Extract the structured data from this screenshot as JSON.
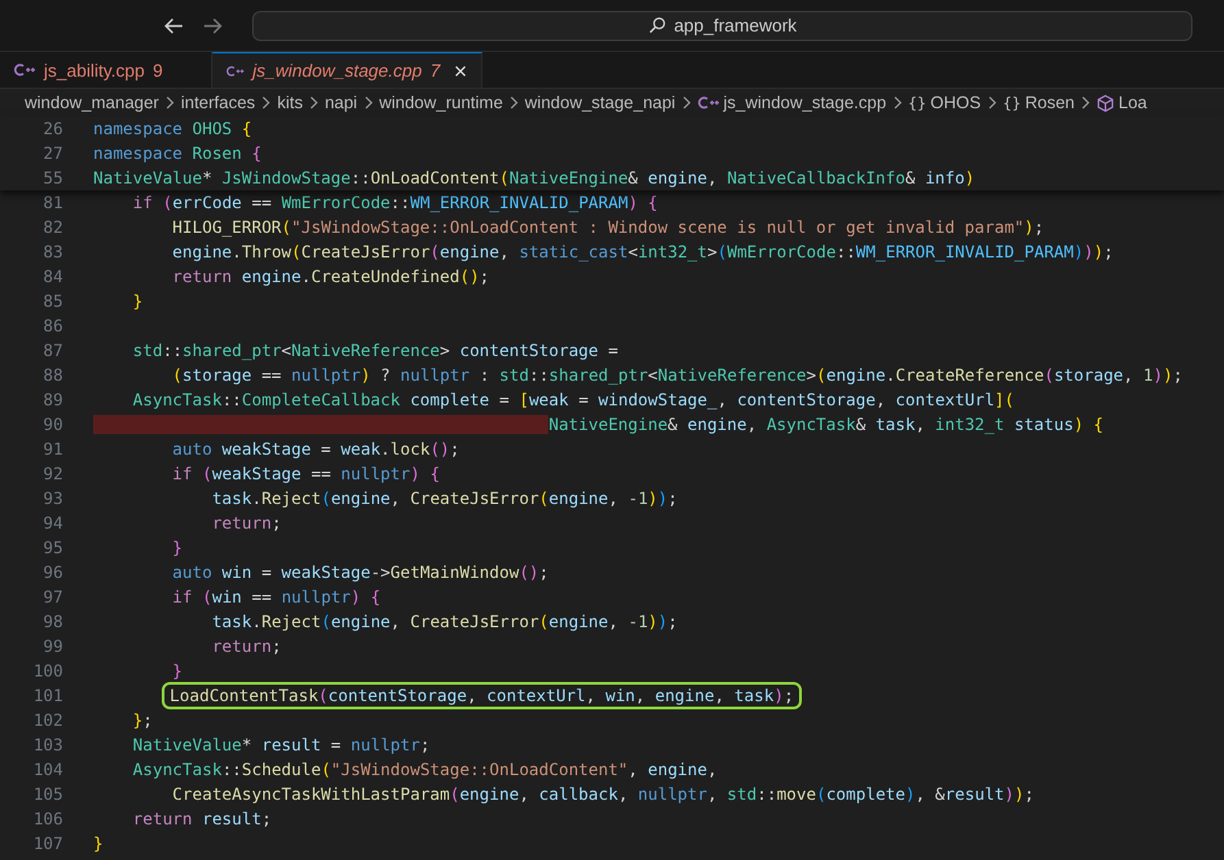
{
  "title_bar": {
    "search": "app_framework"
  },
  "tabs": [
    {
      "label": "js_ability.cpp",
      "problems": "9",
      "selected": false
    },
    {
      "label": "js_window_stage.cpp",
      "problems": "7",
      "selected": true
    }
  ],
  "breadcrumbs": [
    {
      "kind": "folder",
      "text": "window_manager"
    },
    {
      "kind": "folder",
      "text": "interfaces"
    },
    {
      "kind": "folder",
      "text": "kits"
    },
    {
      "kind": "folder",
      "text": "napi"
    },
    {
      "kind": "folder",
      "text": "window_runtime"
    },
    {
      "kind": "folder",
      "text": "window_stage_napi"
    },
    {
      "kind": "file",
      "text": "js_window_stage.cpp"
    },
    {
      "kind": "namespace",
      "icon": "{}",
      "text": "OHOS"
    },
    {
      "kind": "namespace",
      "icon": "{}",
      "text": "Rosen"
    },
    {
      "kind": "method",
      "text": "Loa"
    }
  ],
  "sticky_scroll": [
    {
      "number": "26",
      "tokens": [
        {
          "kind": "kw",
          "text": "namespace "
        },
        {
          "kind": "type",
          "text": "OHOS "
        },
        {
          "kind": "br1",
          "text": "{"
        }
      ]
    },
    {
      "number": "27",
      "tokens": [
        {
          "kind": "kw",
          "text": "namespace "
        },
        {
          "kind": "type",
          "text": "Rosen "
        },
        {
          "kind": "br2",
          "text": "{"
        }
      ]
    },
    {
      "number": "55",
      "tokens": [
        {
          "kind": "type",
          "text": "NativeValue"
        },
        {
          "kind": "plain",
          "text": "* "
        },
        {
          "kind": "type",
          "text": "JsWindowStage"
        },
        {
          "kind": "plain",
          "text": "::"
        },
        {
          "kind": "fn",
          "text": "OnLoadContent"
        },
        {
          "kind": "br1",
          "text": "("
        },
        {
          "kind": "type",
          "text": "NativeEngine"
        },
        {
          "kind": "plain",
          "text": "& "
        },
        {
          "kind": "var",
          "text": "engine"
        },
        {
          "kind": "plain",
          "text": ", "
        },
        {
          "kind": "type",
          "text": "NativeCallbackInfo"
        },
        {
          "kind": "plain",
          "text": "& "
        },
        {
          "kind": "var",
          "text": "info"
        },
        {
          "kind": "br1",
          "text": ")"
        }
      ]
    }
  ],
  "lines": [
    {
      "number": "81",
      "error": false,
      "boxed": false,
      "tokens": [
        {
          "kind": "ctl",
          "text": "    if "
        },
        {
          "kind": "br2",
          "text": "("
        },
        {
          "kind": "var",
          "text": "errCode"
        },
        {
          "kind": "plain",
          "text": " == "
        },
        {
          "kind": "type",
          "text": "WmErrorCode"
        },
        {
          "kind": "plain",
          "text": "::"
        },
        {
          "kind": "enum",
          "text": "WM_ERROR_INVALID_PARAM"
        },
        {
          "kind": "br2",
          "text": ")"
        },
        {
          "kind": "br2",
          "text": " {"
        }
      ]
    },
    {
      "number": "82",
      "error": false,
      "boxed": false,
      "tokens": [
        {
          "kind": "fn",
          "text": "        HILOG_ERROR"
        },
        {
          "kind": "br1",
          "text": "("
        },
        {
          "kind": "str",
          "text": "\"JsWindowStage::OnLoadContent : Window scene is null or get invalid param\""
        },
        {
          "kind": "br1",
          "text": ")"
        },
        {
          "kind": "plain",
          "text": ";"
        }
      ]
    },
    {
      "number": "83",
      "error": false,
      "boxed": false,
      "tokens": [
        {
          "kind": "var",
          "text": "        engine"
        },
        {
          "kind": "plain",
          "text": "."
        },
        {
          "kind": "fn",
          "text": "Throw"
        },
        {
          "kind": "br1",
          "text": "("
        },
        {
          "kind": "fn",
          "text": "CreateJsError"
        },
        {
          "kind": "br2",
          "text": "("
        },
        {
          "kind": "var",
          "text": "engine"
        },
        {
          "kind": "plain",
          "text": ", "
        },
        {
          "kind": "kw",
          "text": "static_cast"
        },
        {
          "kind": "plain",
          "text": "<"
        },
        {
          "kind": "type",
          "text": "int32_t"
        },
        {
          "kind": "plain",
          "text": ">"
        },
        {
          "kind": "br3",
          "text": "("
        },
        {
          "kind": "type",
          "text": "WmErrorCode"
        },
        {
          "kind": "plain",
          "text": "::"
        },
        {
          "kind": "enum",
          "text": "WM_ERROR_INVALID_PARAM"
        },
        {
          "kind": "br3",
          "text": ")"
        },
        {
          "kind": "br2",
          "text": ")"
        },
        {
          "kind": "br1",
          "text": ")"
        },
        {
          "kind": "plain",
          "text": ";"
        }
      ]
    },
    {
      "number": "84",
      "error": false,
      "boxed": false,
      "tokens": [
        {
          "kind": "ctl",
          "text": "        return "
        },
        {
          "kind": "var",
          "text": "engine"
        },
        {
          "kind": "plain",
          "text": "."
        },
        {
          "kind": "fn",
          "text": "CreateUndefined"
        },
        {
          "kind": "br1",
          "text": "()"
        },
        {
          "kind": "plain",
          "text": ";"
        }
      ]
    },
    {
      "number": "85",
      "error": false,
      "boxed": false,
      "tokens": [
        {
          "kind": "br1",
          "text": "    }"
        }
      ]
    },
    {
      "number": "86",
      "error": false,
      "boxed": false
    },
    {
      "number": "87",
      "error": false,
      "boxed": false,
      "tokens": [
        {
          "kind": "type",
          "text": "    std"
        },
        {
          "kind": "plain",
          "text": "::"
        },
        {
          "kind": "type",
          "text": "shared_ptr"
        },
        {
          "kind": "plain",
          "text": "<"
        },
        {
          "kind": "type",
          "text": "NativeReference"
        },
        {
          "kind": "plain",
          "text": "> "
        },
        {
          "kind": "var",
          "text": "contentStorage"
        },
        {
          "kind": "plain",
          "text": " ="
        }
      ]
    },
    {
      "number": "88",
      "error": false,
      "boxed": false,
      "tokens": [
        {
          "kind": "br1",
          "text": "        ("
        },
        {
          "kind": "var",
          "text": "storage"
        },
        {
          "kind": "plain",
          "text": " == "
        },
        {
          "kind": "kw",
          "text": "nullptr"
        },
        {
          "kind": "br1",
          "text": ")"
        },
        {
          "kind": "plain",
          "text": " ? "
        },
        {
          "kind": "kw",
          "text": "nullptr"
        },
        {
          "kind": "plain",
          "text": " : "
        },
        {
          "kind": "type",
          "text": "std"
        },
        {
          "kind": "plain",
          "text": "::"
        },
        {
          "kind": "type",
          "text": "shared_ptr"
        },
        {
          "kind": "plain",
          "text": "<"
        },
        {
          "kind": "type",
          "text": "NativeReference"
        },
        {
          "kind": "plain",
          "text": ">"
        },
        {
          "kind": "br1",
          "text": "("
        },
        {
          "kind": "var",
          "text": "engine"
        },
        {
          "kind": "plain",
          "text": "."
        },
        {
          "kind": "fn",
          "text": "CreateReference"
        },
        {
          "kind": "br2",
          "text": "("
        },
        {
          "kind": "var",
          "text": "storage"
        },
        {
          "kind": "plain",
          "text": ", "
        },
        {
          "kind": "num",
          "text": "1"
        },
        {
          "kind": "br2",
          "text": ")"
        },
        {
          "kind": "br1",
          "text": ")"
        },
        {
          "kind": "plain",
          "text": ";"
        }
      ]
    },
    {
      "number": "89",
      "error": false,
      "boxed": false,
      "tokens": [
        {
          "kind": "type",
          "text": "    AsyncTask"
        },
        {
          "kind": "plain",
          "text": "::"
        },
        {
          "kind": "type",
          "text": "CompleteCallback"
        },
        {
          "kind": "var",
          "text": " complete"
        },
        {
          "kind": "plain",
          "text": " = "
        },
        {
          "kind": "br1",
          "text": "["
        },
        {
          "kind": "var",
          "text": "weak"
        },
        {
          "kind": "plain",
          "text": " = "
        },
        {
          "kind": "var",
          "text": "windowStage_"
        },
        {
          "kind": "plain",
          "text": ", "
        },
        {
          "kind": "var",
          "text": "contentStorage"
        },
        {
          "kind": "plain",
          "text": ", "
        },
        {
          "kind": "var",
          "text": "contextUrl"
        },
        {
          "kind": "br1",
          "text": "]"
        },
        {
          "kind": "br1",
          "text": "("
        }
      ]
    },
    {
      "number": "90",
      "error": true,
      "boxed": false,
      "tokens": [
        {
          "kind": "type",
          "text": "                                              NativeEngine"
        },
        {
          "kind": "plain",
          "text": "& "
        },
        {
          "kind": "var",
          "text": "engine"
        },
        {
          "kind": "plain",
          "text": ", "
        },
        {
          "kind": "type",
          "text": "AsyncTask"
        },
        {
          "kind": "plain",
          "text": "& "
        },
        {
          "kind": "var",
          "text": "task"
        },
        {
          "kind": "plain",
          "text": ", "
        },
        {
          "kind": "type",
          "text": "int32_t"
        },
        {
          "kind": "var",
          "text": " status"
        },
        {
          "kind": "br1",
          "text": ")"
        },
        {
          "kind": "br1",
          "text": " {"
        }
      ]
    },
    {
      "number": "91",
      "error": false,
      "boxed": false,
      "tokens": [
        {
          "kind": "kw",
          "text": "        auto "
        },
        {
          "kind": "var",
          "text": "weakStage"
        },
        {
          "kind": "plain",
          "text": " = "
        },
        {
          "kind": "var",
          "text": "weak"
        },
        {
          "kind": "plain",
          "text": "."
        },
        {
          "kind": "fn",
          "text": "lock"
        },
        {
          "kind": "br2",
          "text": "()"
        },
        {
          "kind": "plain",
          "text": ";"
        }
      ]
    },
    {
      "number": "92",
      "error": false,
      "boxed": false,
      "tokens": [
        {
          "kind": "ctl",
          "text": "        if "
        },
        {
          "kind": "br2",
          "text": "("
        },
        {
          "kind": "var",
          "text": "weakStage"
        },
        {
          "kind": "plain",
          "text": " == "
        },
        {
          "kind": "kw",
          "text": "nullptr"
        },
        {
          "kind": "br2",
          "text": ")"
        },
        {
          "kind": "br2",
          "text": " {"
        }
      ]
    },
    {
      "number": "93",
      "error": false,
      "boxed": false,
      "tokens": [
        {
          "kind": "var",
          "text": "            task"
        },
        {
          "kind": "plain",
          "text": "."
        },
        {
          "kind": "fn",
          "text": "Reject"
        },
        {
          "kind": "br3",
          "text": "("
        },
        {
          "kind": "var",
          "text": "engine"
        },
        {
          "kind": "plain",
          "text": ", "
        },
        {
          "kind": "fn",
          "text": "CreateJsError"
        },
        {
          "kind": "br1",
          "text": "("
        },
        {
          "kind": "var",
          "text": "engine"
        },
        {
          "kind": "plain",
          "text": ", "
        },
        {
          "kind": "num",
          "text": "-1"
        },
        {
          "kind": "br1",
          "text": ")"
        },
        {
          "kind": "br3",
          "text": ")"
        },
        {
          "kind": "plain",
          "text": ";"
        }
      ]
    },
    {
      "number": "94",
      "error": false,
      "boxed": false,
      "tokens": [
        {
          "kind": "ctl",
          "text": "            return"
        },
        {
          "kind": "plain",
          "text": ";"
        }
      ]
    },
    {
      "number": "95",
      "error": false,
      "boxed": false,
      "tokens": [
        {
          "kind": "br2",
          "text": "        }"
        }
      ]
    },
    {
      "number": "96",
      "error": false,
      "boxed": false,
      "tokens": [
        {
          "kind": "kw",
          "text": "        auto "
        },
        {
          "kind": "var",
          "text": "win"
        },
        {
          "kind": "plain",
          "text": " = "
        },
        {
          "kind": "var",
          "text": "weakStage"
        },
        {
          "kind": "plain",
          "text": "->"
        },
        {
          "kind": "fn",
          "text": "GetMainWindow"
        },
        {
          "kind": "br2",
          "text": "()"
        },
        {
          "kind": "plain",
          "text": ";"
        }
      ]
    },
    {
      "number": "97",
      "error": false,
      "boxed": false,
      "tokens": [
        {
          "kind": "ctl",
          "text": "        if "
        },
        {
          "kind": "br2",
          "text": "("
        },
        {
          "kind": "var",
          "text": "win"
        },
        {
          "kind": "plain",
          "text": " == "
        },
        {
          "kind": "kw",
          "text": "nullptr"
        },
        {
          "kind": "br2",
          "text": ")"
        },
        {
          "kind": "br2",
          "text": " {"
        }
      ]
    },
    {
      "number": "98",
      "error": false,
      "boxed": false,
      "tokens": [
        {
          "kind": "var",
          "text": "            task"
        },
        {
          "kind": "plain",
          "text": "."
        },
        {
          "kind": "fn",
          "text": "Reject"
        },
        {
          "kind": "br3",
          "text": "("
        },
        {
          "kind": "var",
          "text": "engine"
        },
        {
          "kind": "plain",
          "text": ", "
        },
        {
          "kind": "fn",
          "text": "CreateJsError"
        },
        {
          "kind": "br1",
          "text": "("
        },
        {
          "kind": "var",
          "text": "engine"
        },
        {
          "kind": "plain",
          "text": ", "
        },
        {
          "kind": "num",
          "text": "-1"
        },
        {
          "kind": "br1",
          "text": ")"
        },
        {
          "kind": "br3",
          "text": ")"
        },
        {
          "kind": "plain",
          "text": ";"
        }
      ]
    },
    {
      "number": "99",
      "error": false,
      "boxed": false,
      "tokens": [
        {
          "kind": "ctl",
          "text": "            return"
        },
        {
          "kind": "plain",
          "text": ";"
        }
      ]
    },
    {
      "number": "100",
      "error": false,
      "boxed": false,
      "tokens": [
        {
          "kind": "br2",
          "text": "        }"
        }
      ]
    },
    {
      "number": "101",
      "error": false,
      "boxed": true,
      "tokens": [
        {
          "kind": "fn",
          "text": "        LoadContentTask"
        },
        {
          "kind": "br2",
          "text": "("
        },
        {
          "kind": "var",
          "text": "contentStorage"
        },
        {
          "kind": "plain",
          "text": ", "
        },
        {
          "kind": "var",
          "text": "contextUrl"
        },
        {
          "kind": "plain",
          "text": ", "
        },
        {
          "kind": "var",
          "text": "win"
        },
        {
          "kind": "plain",
          "text": ", "
        },
        {
          "kind": "var",
          "text": "engine"
        },
        {
          "kind": "plain",
          "text": ", "
        },
        {
          "kind": "var",
          "text": "task"
        },
        {
          "kind": "br2",
          "text": ")"
        },
        {
          "kind": "plain",
          "text": ";"
        }
      ]
    },
    {
      "number": "102",
      "error": false,
      "boxed": false,
      "tokens": [
        {
          "kind": "br1",
          "text": "    }"
        },
        {
          "kind": "plain",
          "text": ";"
        }
      ]
    },
    {
      "number": "103",
      "error": false,
      "boxed": false,
      "tokens": [
        {
          "kind": "type",
          "text": "    NativeValue"
        },
        {
          "kind": "plain",
          "text": "* "
        },
        {
          "kind": "var",
          "text": "result"
        },
        {
          "kind": "plain",
          "text": " = "
        },
        {
          "kind": "kw",
          "text": "nullptr"
        },
        {
          "kind": "plain",
          "text": ";"
        }
      ]
    },
    {
      "number": "104",
      "error": false,
      "boxed": false,
      "tokens": [
        {
          "kind": "type",
          "text": "    AsyncTask"
        },
        {
          "kind": "plain",
          "text": "::"
        },
        {
          "kind": "fn",
          "text": "Schedule"
        },
        {
          "kind": "br1",
          "text": "("
        },
        {
          "kind": "str",
          "text": "\"JsWindowStage::OnLoadContent\""
        },
        {
          "kind": "plain",
          "text": ", "
        },
        {
          "kind": "var",
          "text": "engine"
        },
        {
          "kind": "plain",
          "text": ","
        }
      ]
    },
    {
      "number": "105",
      "error": false,
      "boxed": false,
      "tokens": [
        {
          "kind": "fn",
          "text": "        CreateAsyncTaskWithLastParam"
        },
        {
          "kind": "br2",
          "text": "("
        },
        {
          "kind": "var",
          "text": "engine"
        },
        {
          "kind": "plain",
          "text": ", "
        },
        {
          "kind": "var",
          "text": "callback"
        },
        {
          "kind": "plain",
          "text": ", "
        },
        {
          "kind": "kw",
          "text": "nullptr"
        },
        {
          "kind": "plain",
          "text": ", "
        },
        {
          "kind": "type",
          "text": "std"
        },
        {
          "kind": "plain",
          "text": "::"
        },
        {
          "kind": "fn",
          "text": "move"
        },
        {
          "kind": "br3",
          "text": "("
        },
        {
          "kind": "var",
          "text": "complete"
        },
        {
          "kind": "br3",
          "text": ")"
        },
        {
          "kind": "plain",
          "text": ", &"
        },
        {
          "kind": "var",
          "text": "result"
        },
        {
          "kind": "br2",
          "text": ")"
        },
        {
          "kind": "br1",
          "text": ")"
        },
        {
          "kind": "plain",
          "text": ";"
        }
      ]
    },
    {
      "number": "106",
      "error": false,
      "boxed": false,
      "tokens": [
        {
          "kind": "ctl",
          "text": "    return "
        },
        {
          "kind": "var",
          "text": "result"
        },
        {
          "kind": "plain",
          "text": ";"
        }
      ]
    },
    {
      "number": "107",
      "error": false,
      "boxed": false,
      "tokens": [
        {
          "kind": "br1",
          "text": "}"
        }
      ]
    }
  ]
}
